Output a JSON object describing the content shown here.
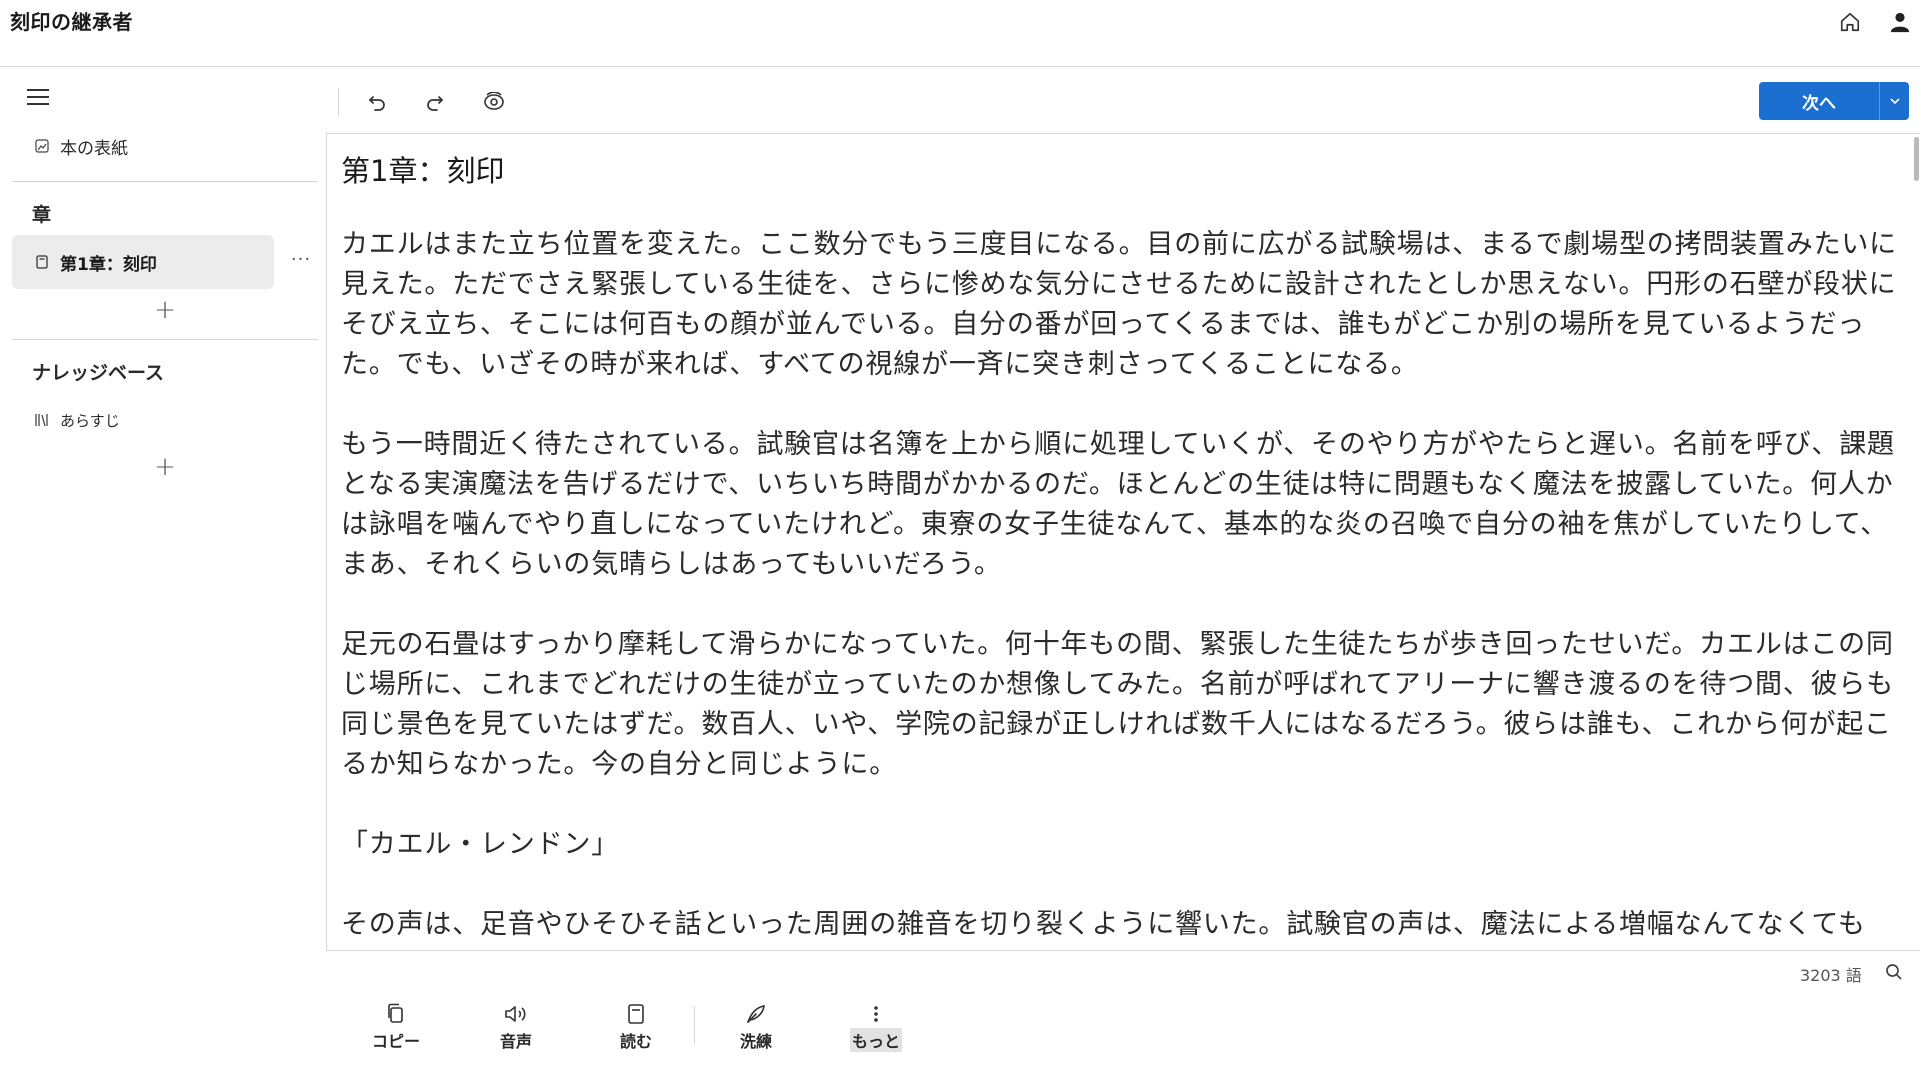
{
  "app": {
    "title": "刻印の継承者"
  },
  "header": {
    "home_icon": "home-icon",
    "account_icon": "user-icon"
  },
  "sidebar": {
    "cover_label": "本の表紙",
    "chapters_heading": "章",
    "chapters": [
      {
        "label": "第1章：刻印",
        "more": "···"
      }
    ],
    "add_symbol": "+",
    "knowledge_heading": "ナレッジベース",
    "knowledge_items": [
      {
        "label": "あらすじ"
      }
    ]
  },
  "toolbar": {
    "undo_icon": "undo-icon",
    "redo_icon": "redo-icon",
    "eye_icon": "preview-icon",
    "next_label": "次へ"
  },
  "editor": {
    "chapter_title": "第1章：刻印",
    "paragraphs": [
      "カエルはまた立ち位置を変えた。ここ数分でもう三度目になる。目の前に広がる試験場は、まるで劇場型の拷問装置みたいに見えた。ただでさえ緊張している生徒を、さらに惨めな気分にさせるために設計されたとしか思えない。円形の石壁が段状にそびえ立ち、そこには何百もの顔が並んでいる。自分の番が回ってくるまでは、誰もがどこか別の場所を見ているようだった。でも、いざその時が来れば、すべての視線が一斉に突き刺さってくることになる。",
      "もう一時間近く待たされている。試験官は名簿を上から順に処理していくが、そのやり方がやたらと遅い。名前を呼び、課題となる実演魔法を告げるだけで、いちいち時間がかかるのだ。ほとんどの生徒は特に問題もなく魔法を披露していた。何人かは詠唱を噛んでやり直しになっていたけれど。東寮の女子生徒なんて、基本的な炎の召喚で自分の袖を焦がしていたりして、まあ、それくらいの気晴らしはあってもいいだろう。",
      "足元の石畳はすっかり摩耗して滑らかになっていた。何十年もの間、緊張した生徒たちが歩き回ったせいだ。カエルはこの同じ場所に、これまでどれだけの生徒が立っていたのか想像してみた。名前が呼ばれてアリーナに響き渡るのを待つ間、彼らも同じ景色を見ていたはずだ。数百人、いや、学院の記録が正しければ数千人にはなるだろう。彼らは誰も、これから何が起こるか知らなかった。今の自分と同じように。",
      "「カエル・レンドン」",
      "その声は、足音やひそひそ話といった周囲の雑音を切り裂くように響いた。試験官の声は、魔法による増幅なんてなくても"
    ]
  },
  "status": {
    "word_count": "3203 語",
    "search_icon": "search-icon"
  },
  "actions": [
    {
      "label": "コピー",
      "icon": "copy-icon"
    },
    {
      "label": "音声",
      "icon": "speaker-icon"
    },
    {
      "label": "読む",
      "icon": "book-icon"
    },
    {
      "label": "洗練",
      "icon": "quill-icon"
    },
    {
      "label": "もっと",
      "icon": "more-vertical-icon"
    }
  ],
  "colors": {
    "accent": "#1a6fd1",
    "border": "#d6d6d6",
    "selected_row": "#ececec"
  }
}
